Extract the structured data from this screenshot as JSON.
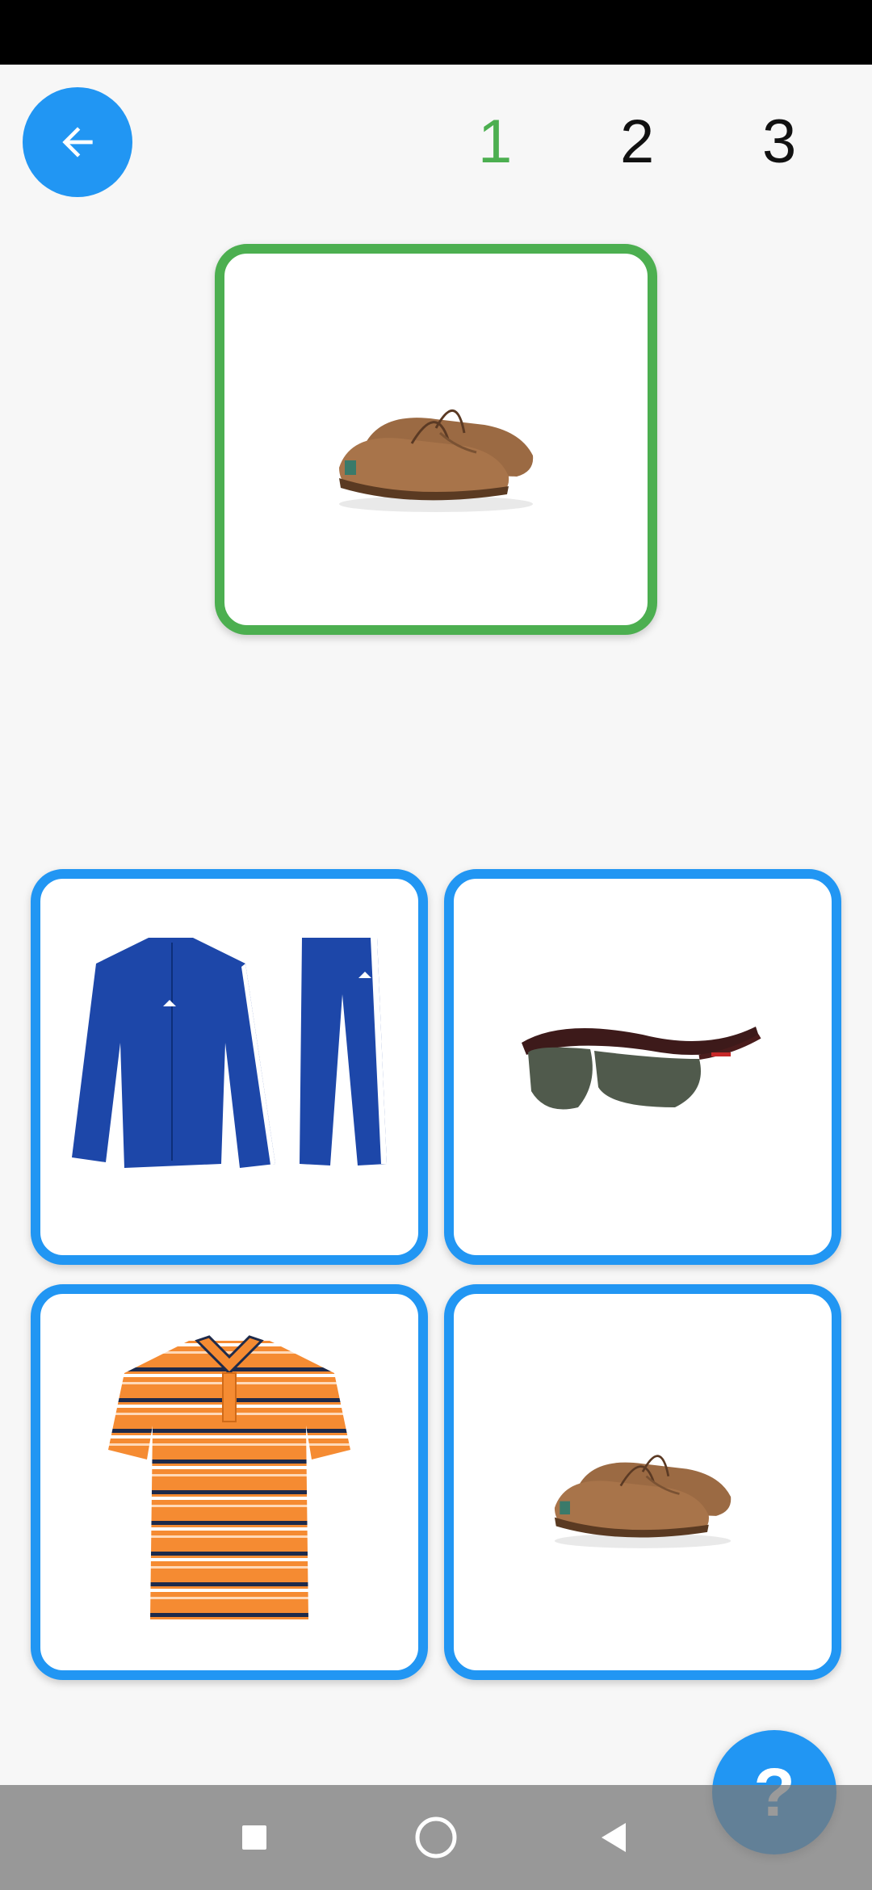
{
  "header": {
    "back_icon": "arrow-left-icon",
    "steps": [
      {
        "label": "1",
        "active": true
      },
      {
        "label": "2",
        "active": false
      },
      {
        "label": "3",
        "active": false
      }
    ]
  },
  "target": {
    "item": "boat-shoes"
  },
  "options": [
    {
      "item": "tracksuit"
    },
    {
      "item": "sunglasses"
    },
    {
      "item": "striped-polo-shirt"
    },
    {
      "item": "boat-shoes"
    }
  ],
  "help_button": {
    "label": "?"
  },
  "navigation_bar": {
    "icons": [
      "square-recent-icon",
      "circle-home-icon",
      "triangle-back-icon"
    ]
  },
  "colors": {
    "accent": "#2196f3",
    "active_step": "#4caf50",
    "background": "#f7f7f7"
  }
}
